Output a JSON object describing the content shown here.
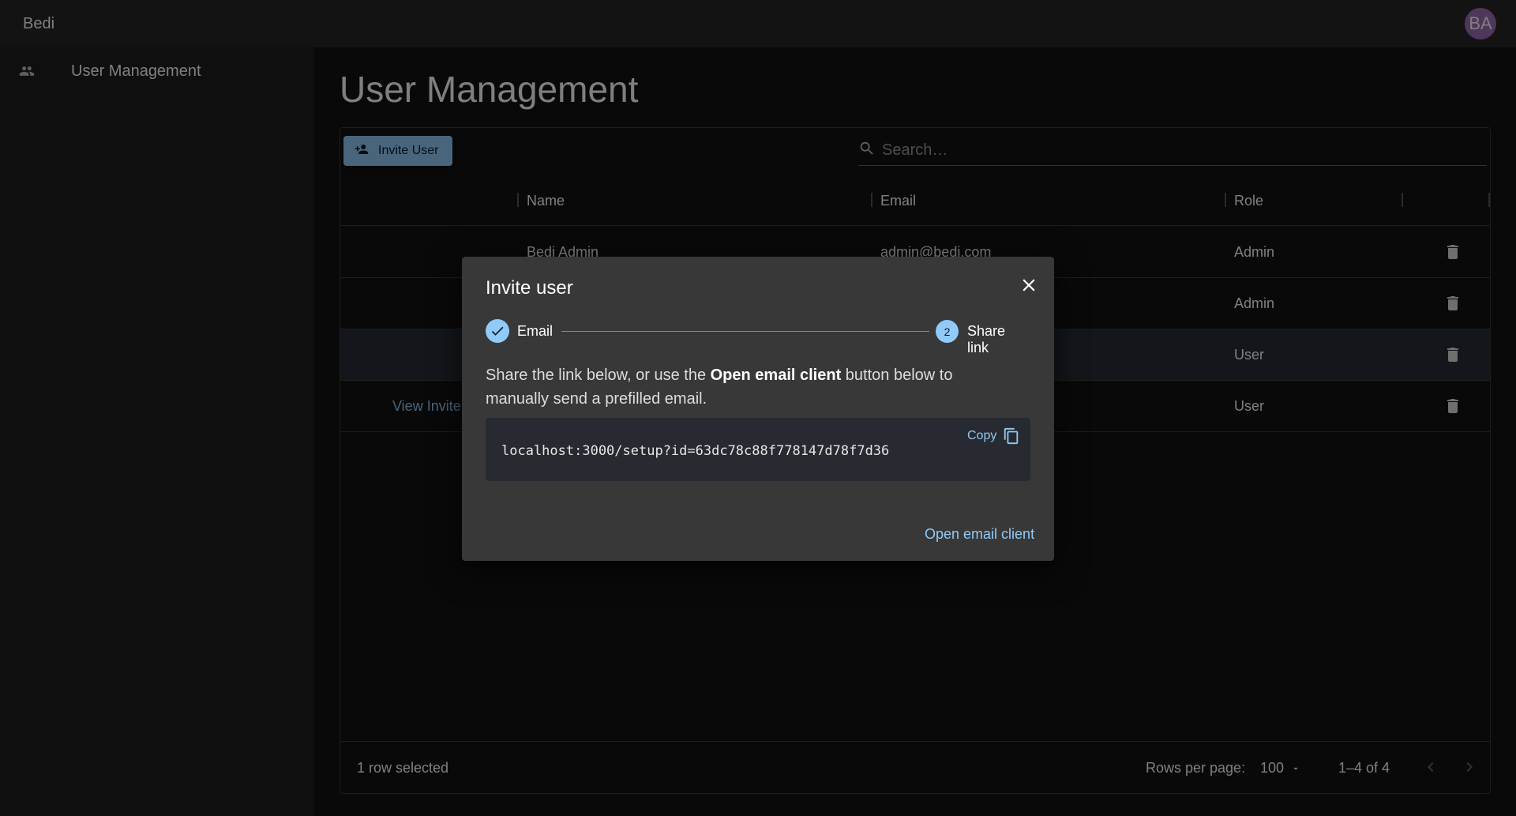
{
  "app": {
    "brand": "Bedi",
    "avatar_initials": "BA"
  },
  "sidebar": {
    "items": [
      {
        "label": "User Management",
        "icon": "people-icon"
      }
    ]
  },
  "page": {
    "title": "User Management"
  },
  "toolbar": {
    "invite_label": "Invite User",
    "search_placeholder": "Search…"
  },
  "table": {
    "columns": [
      "Name",
      "Email",
      "Role"
    ],
    "rows": [
      {
        "name": "Bedi Admin",
        "email": "admin@bedi.com",
        "role": "Admin",
        "action": "",
        "selected": false
      },
      {
        "name": "",
        "email": "",
        "role": "Admin",
        "action": "",
        "selected": false
      },
      {
        "name": "",
        "email": "",
        "role": "User",
        "action": "",
        "selected": true
      },
      {
        "name": "",
        "email": "",
        "role": "User",
        "action": "View Invite",
        "selected": false
      }
    ]
  },
  "footer": {
    "selection": "1 row selected",
    "rows_per_page_label": "Rows per page:",
    "rows_per_page_value": "100",
    "range": "1–4 of 4"
  },
  "dialog": {
    "title": "Invite user",
    "steps": [
      {
        "label": "Email",
        "state": "completed"
      },
      {
        "number": "2",
        "label": "Share link",
        "state": "active"
      }
    ],
    "desc_prefix": "Share the link below, or use the ",
    "desc_bold": "Open email client",
    "desc_suffix": " button below to manually send a prefilled email.",
    "link": "localhost:3000/setup?id=63dc78c88f778147d78f7d36",
    "copy_label": "Copy",
    "open_email_label": "Open email client"
  },
  "colors": {
    "accent": "#90caf9",
    "background": "#121212",
    "dialog": "#383838",
    "avatar": "#9c6fb6"
  }
}
